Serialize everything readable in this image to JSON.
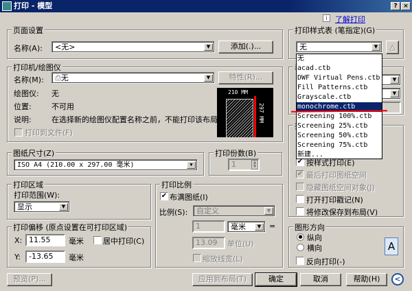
{
  "window": {
    "title": "打印 - 模型",
    "help_btn": "?",
    "close_btn": "×"
  },
  "help_link": "了解打印",
  "page_setup": {
    "legend": "页面设置",
    "name_label": "名称(A):",
    "name_value": "<无>",
    "add_button": "添加(.)..."
  },
  "printer": {
    "legend": "打印机/绘图仪",
    "name_label": "名称(M):",
    "name_value": "无",
    "properties_button": "特性(R)...",
    "plotter_label": "绘图仪:",
    "plotter_value": "无",
    "location_label": "位置:",
    "location_value": "不可用",
    "desc_label": "说明:",
    "desc_value": "在选择新的绘图仪配置名称之前，不能打印该布局。",
    "plot_to_file": "打印到文件(F)",
    "preview_width": "210 MM",
    "preview_height": "297 MM"
  },
  "paper_size": {
    "legend": "图纸尺寸(Z)",
    "value": "ISO A4 (210.00 x 297.00 毫米)"
  },
  "copies": {
    "legend": "打印份数(B)",
    "value": "1"
  },
  "plot_area": {
    "legend": "打印区域",
    "range_label": "打印范围(W):",
    "range_value": "显示"
  },
  "offset": {
    "legend": "打印偏移 (原点设置在可打印区域)",
    "x_label": "X:",
    "x_value": "11.55",
    "y_label": "Y:",
    "y_value": "-13.65",
    "unit": "毫米",
    "center_label": "居中打印(C)"
  },
  "scale": {
    "legend": "打印比例",
    "fit_label": "布满图纸(I)",
    "ratio_label": "比例(S):",
    "ratio_value": "自定义",
    "num_value": "1",
    "unit_value": "毫米",
    "eq": "=",
    "den_value": "13.09",
    "den_unit": "单位(U)",
    "lineweight_label": "缩放线宽(L)"
  },
  "plot_style": {
    "legend": "打印样式表 (笔指定)(G)",
    "value": "无",
    "options": [
      "无",
      "acad.ctb",
      "DWF Virtual Pens.ctb",
      "Fill Patterns.ctb",
      "Grayscale.ctb",
      "monochrome.ctb",
      "Screening 100%.ctb",
      "Screening 25%.ctb",
      "Screening 50%.ctb",
      "Screening 75%.ctb",
      "新建..."
    ],
    "selected": "monochrome.ctb"
  },
  "shaded": {
    "legend_partial": "着"
  },
  "plot_options": {
    "legend_partial": "打",
    "items": [
      "按样式打印(E)",
      "最后打印图纸空间",
      "隐藏图纸空间对象(J)",
      "打开打印戳记(N)",
      "将修改保存到布局(V)"
    ]
  },
  "orientation": {
    "legend": "图形方向",
    "portrait": "纵向",
    "landscape": "横向",
    "reverse": "反向打印(-)",
    "icon_letter": "A"
  },
  "buttons": {
    "preview": "预览(P)...",
    "apply": "应用到布局(T)",
    "ok": "确定",
    "cancel": "取消",
    "help": "帮助(H)",
    "collapse": "<"
  },
  "colors": {
    "title_bar": "#0a246a",
    "highlight": "#0a246a",
    "annotation": "#ff0000"
  }
}
